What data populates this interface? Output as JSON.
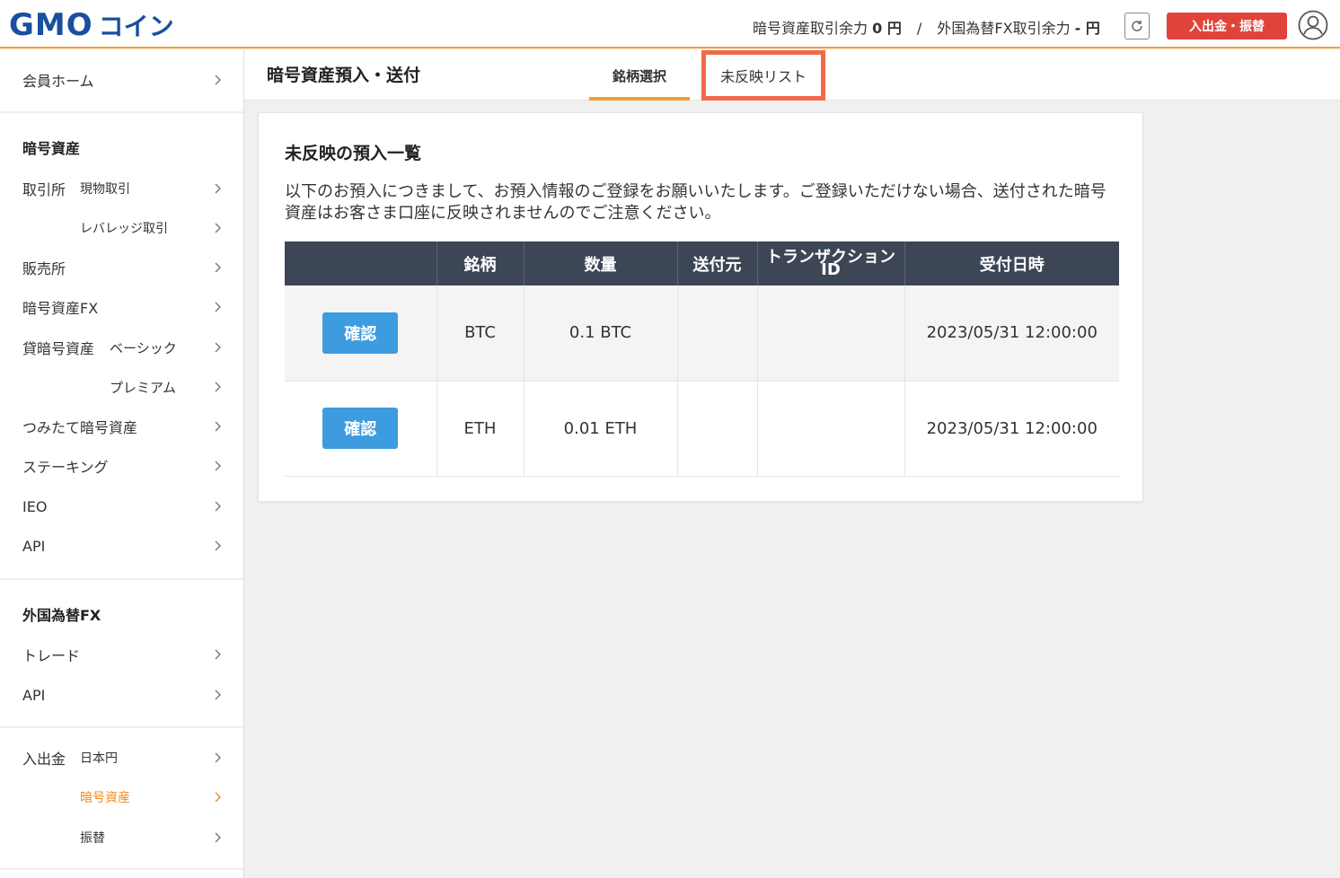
{
  "header": {
    "logo_main": "GMO",
    "logo_sub": "コイン",
    "crypto_balance_label": "暗号資産取引余力",
    "crypto_balance_value": "0 円",
    "separator": "/",
    "fx_balance_label": "外国為替FX取引余力",
    "fx_balance_value": "- 円",
    "deposit_button": "入出金・振替"
  },
  "sidebar": {
    "member_home": "会員ホーム",
    "crypto_heading": "暗号資産",
    "exchange": "取引所",
    "spot": "現物取引",
    "leverage": "レバレッジ取引",
    "sales": "販売所",
    "crypto_fx": "暗号資産FX",
    "lending": "貸暗号資産",
    "basic": "ベーシック",
    "premium": "プレミアム",
    "tsumitate": "つみたて暗号資産",
    "staking": "ステーキング",
    "ieo": "IEO",
    "api": "API",
    "fx_heading": "外国為替FX",
    "trade": "トレード",
    "fx_api": "API",
    "deposit": "入出金",
    "jpy": "日本円",
    "crypto": "暗号資産",
    "transfer": "振替"
  },
  "main": {
    "page_title": "暗号資産預入・送付",
    "tabs": [
      {
        "label": "銘柄選択"
      },
      {
        "label": "未反映リスト"
      }
    ],
    "card_title": "未反映の預入一覧",
    "card_desc": "以下のお預入につきまして、お預入情報のご登録をお願いいたします。ご登録いただけない場合、送付された暗号資産はお客さま口座に反映されませんのでご注意ください。",
    "table": {
      "headers": [
        "",
        "銘柄",
        "数量",
        "送付元",
        "トランザクションID",
        "受付日時"
      ],
      "rows": [
        {
          "action": "確認",
          "symbol": "BTC",
          "quantity": "0.1 BTC",
          "source": "",
          "txid": "",
          "received": "2023/05/31 12:00:00"
        },
        {
          "action": "確認",
          "symbol": "ETH",
          "quantity": "0.01 ETH",
          "source": "",
          "txid": "",
          "received": "2023/05/31 12:00:00"
        }
      ]
    }
  },
  "colors": {
    "accent_orange": "#f0a030",
    "header_dark": "#3c4655",
    "button_blue": "#3d9be0",
    "deposit_red": "#e0433a",
    "tab_highlight": "#f26a4a",
    "brand_blue": "#1a4fa0"
  }
}
